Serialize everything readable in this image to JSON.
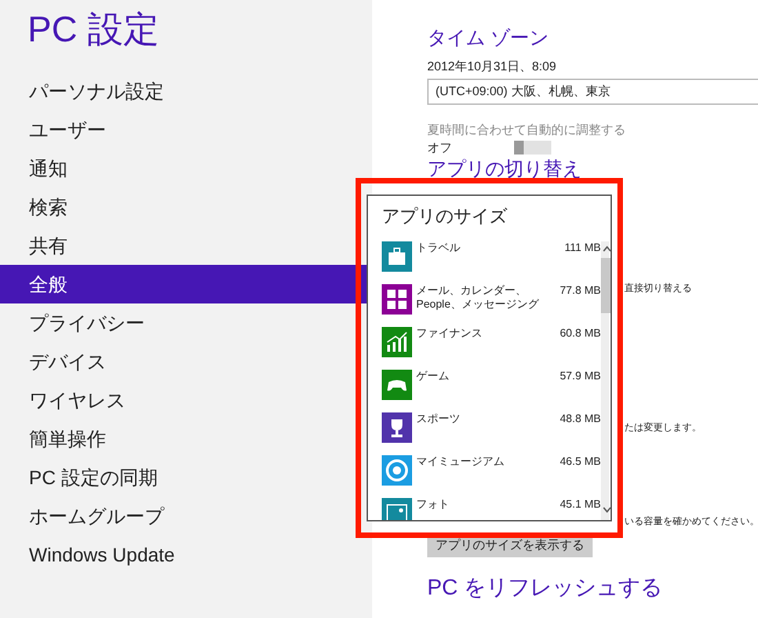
{
  "sidebar": {
    "title": "PC 設定",
    "items": [
      {
        "label": "パーソナル設定",
        "selected": false
      },
      {
        "label": "ユーザー",
        "selected": false
      },
      {
        "label": "通知",
        "selected": false
      },
      {
        "label": "検索",
        "selected": false
      },
      {
        "label": "共有",
        "selected": false
      },
      {
        "label": "全般",
        "selected": true
      },
      {
        "label": "プライバシー",
        "selected": false
      },
      {
        "label": "デバイス",
        "selected": false
      },
      {
        "label": "ワイヤレス",
        "selected": false
      },
      {
        "label": "簡単操作",
        "selected": false
      },
      {
        "label": "PC 設定の同期",
        "selected": false
      },
      {
        "label": "ホームグループ",
        "selected": false
      },
      {
        "label": "Windows Update",
        "selected": false
      }
    ]
  },
  "content": {
    "time_zone_heading": "タイム ゾーン",
    "date_time": "2012年10月31日、8:09",
    "time_zone_select": "(UTC+09:00) 大阪、札幌、東京",
    "dst_label": "夏時間に合わせて自動的に調整する",
    "dst_toggle": {
      "label": "オフ",
      "on": false
    },
    "app_switch_heading": "アプリの切り替え",
    "text_1": "直接切り替える",
    "text_2": "たは変更します。",
    "text_3": "いる容量を確かめてください。",
    "button": "アプリのサイズを表示する",
    "refresh_heading": "PC をリフレッシュする"
  },
  "popup": {
    "title": "アプリのサイズ",
    "highlighted": true,
    "apps": [
      {
        "name": "トラベル",
        "size": "111 MB",
        "color": "#138a9e",
        "kind": "suitcase"
      },
      {
        "name": "メール、カレンダー、People、メッセージング",
        "size": "77.8 MB",
        "color": "#8c0095",
        "kind": "tiles"
      },
      {
        "name": "ファイナンス",
        "size": "60.8 MB",
        "color": "#128a12",
        "kind": "chart"
      },
      {
        "name": "ゲーム",
        "size": "57.9 MB",
        "color": "#128a12",
        "kind": "gamepad"
      },
      {
        "name": "スポーツ",
        "size": "48.8 MB",
        "color": "#5133ab",
        "kind": "trophy"
      },
      {
        "name": "マイミュージアム",
        "size": "46.5 MB",
        "color": "#1b9de2",
        "kind": "medallion"
      },
      {
        "name": "フォト",
        "size": "45.1 MB",
        "color": "#138a9e",
        "kind": "photo"
      }
    ]
  }
}
